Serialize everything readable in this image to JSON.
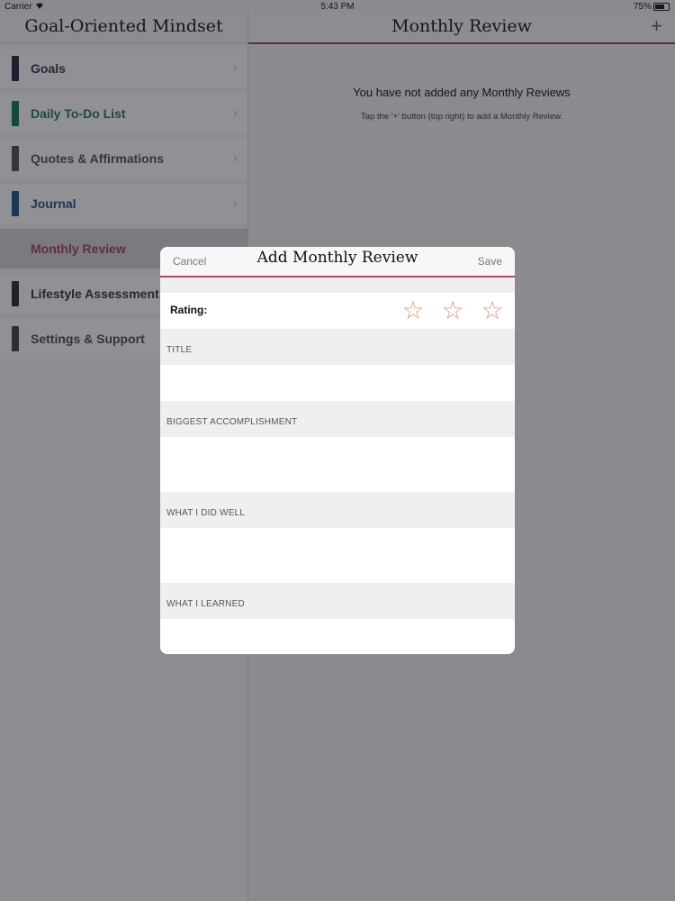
{
  "status": {
    "carrier": "Carrier",
    "time": "5:43 PM",
    "battery": "75%"
  },
  "sidebar": {
    "title": "Goal-Oriented Mindset",
    "items": [
      {
        "label": "Goals",
        "color": "#3a3f52",
        "bar": "#2b3247"
      },
      {
        "label": "Daily To-Do List",
        "color": "#2e7d6b",
        "bar": "#1e7a66"
      },
      {
        "label": "Quotes & Affirmations",
        "color": "#5b5566",
        "bar": "#5a5567"
      },
      {
        "label": "Journal",
        "color": "#2d5a8e",
        "bar": "#2d5a8e"
      },
      {
        "label": "Monthly Review",
        "color": "#a94a66",
        "bar": ""
      },
      {
        "label": "Lifestyle Assessment",
        "color": "#3c3c46",
        "bar": "#34343c"
      },
      {
        "label": "Settings & Support",
        "color": "#55555e",
        "bar": "#4a4a52"
      }
    ]
  },
  "main": {
    "title": "Monthly Review",
    "add_icon": "plus-icon",
    "empty_title": "You have not added any Monthly Reviews",
    "empty_hint": "Tap the '+' button (top right) to add a Monthly Review."
  },
  "modal": {
    "cancel": "Cancel",
    "title": "Add Monthly Review",
    "save": "Save",
    "rating_label": "Rating:",
    "rating_value": 0,
    "rating_max": 3,
    "sections": [
      "TITLE",
      "BIGGEST ACCOMPLISHMENT",
      "WHAT I DID WELL",
      "WHAT I LEARNED"
    ]
  },
  "colors": {
    "accent": "#a94a66",
    "star": "#d99a7a"
  }
}
